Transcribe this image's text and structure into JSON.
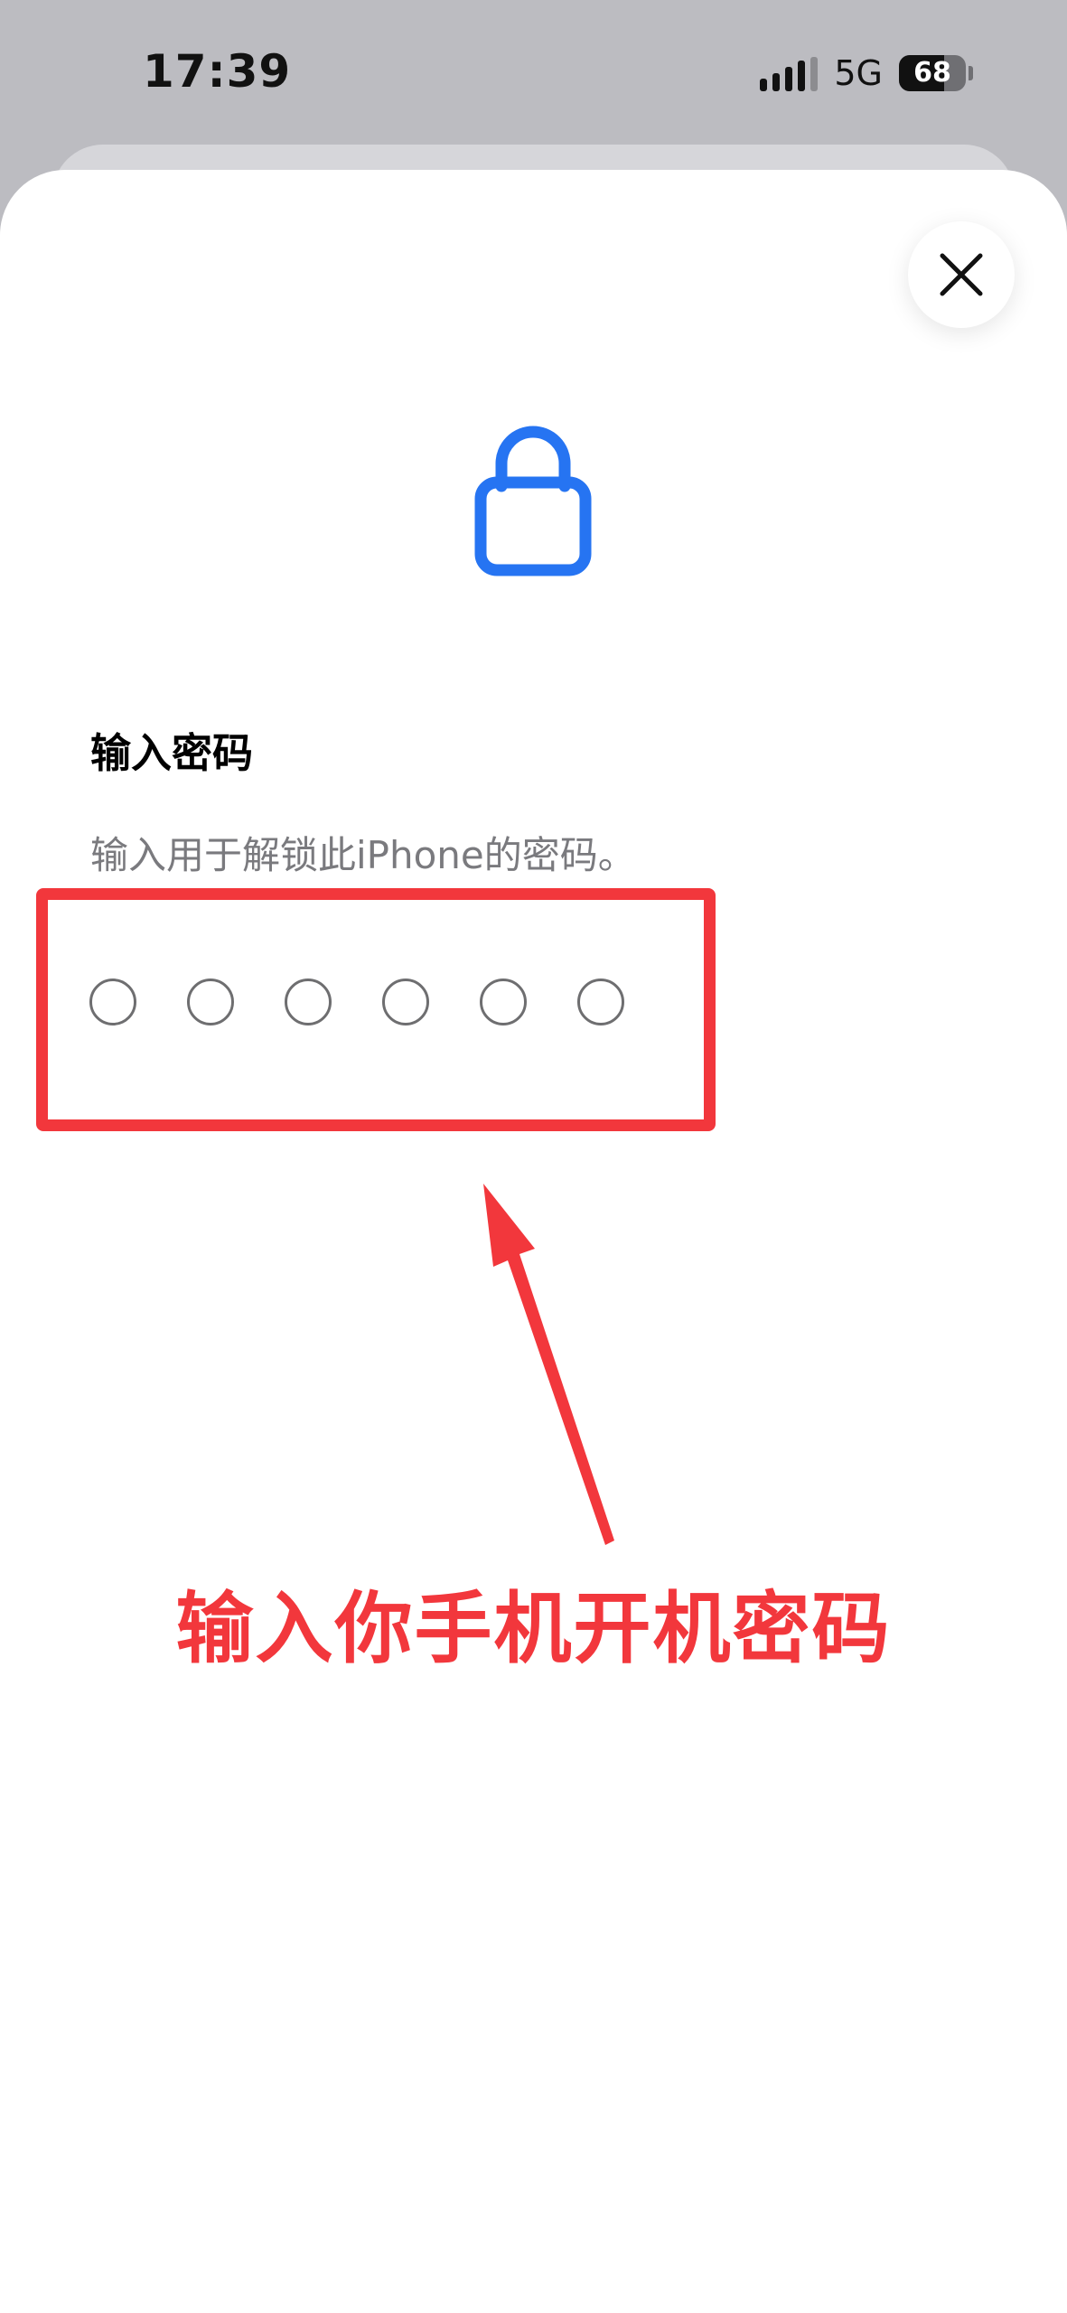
{
  "status_bar": {
    "time": "17:39",
    "network": "5G",
    "battery": "68",
    "battery_level": 0.68,
    "signal_icon": "cellular-signal-icon"
  },
  "sheet": {
    "close_icon": "close-icon",
    "lock_icon": "lock-icon",
    "title": "输入密码",
    "subtitle": "输入用于解锁此iPhone的密码。",
    "passcode_length": 6,
    "passcode_dots": [
      "",
      "",
      "",
      "",
      "",
      ""
    ]
  },
  "annotation": {
    "text": "输入你手机开机密码",
    "color": "#f2373c",
    "arrow_icon": "arrow-up-icon"
  },
  "colors": {
    "accent": "#2674f2",
    "annotation_red": "#f2373c",
    "background": "#bcbcc1"
  }
}
